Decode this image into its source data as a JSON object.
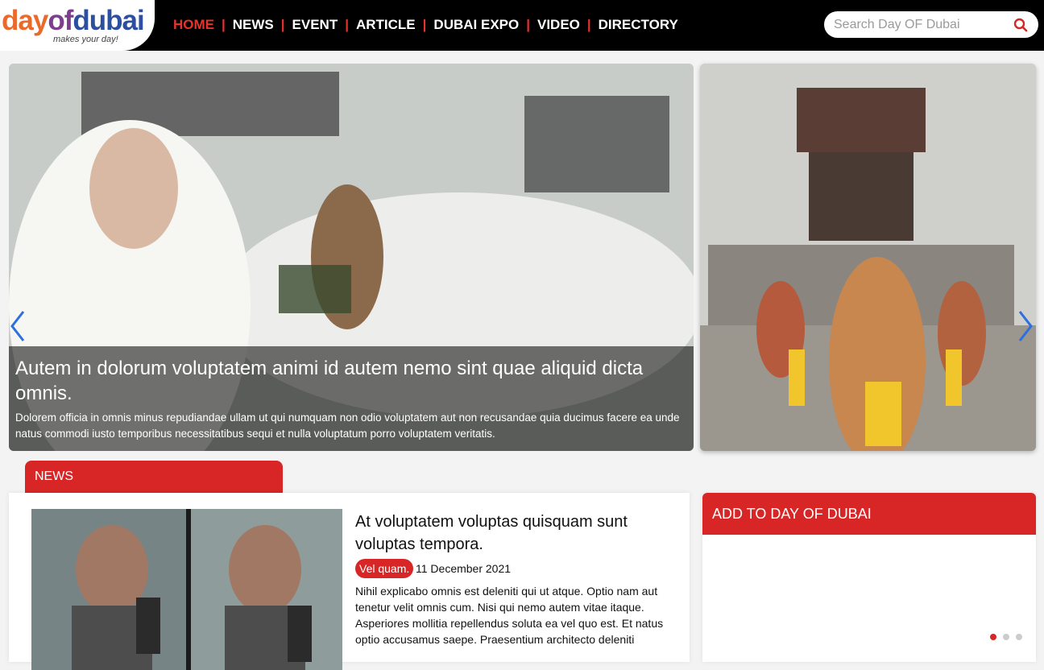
{
  "logo": {
    "part1": "day",
    "part2": "of",
    "part3": "dubai",
    "tagline": "makes your day!"
  },
  "nav": {
    "items": [
      {
        "label": "HOME"
      },
      {
        "label": "NEWS"
      },
      {
        "label": "EVENT"
      },
      {
        "label": "ARTICLE"
      },
      {
        "label": "DUBAI EXPO"
      },
      {
        "label": "VIDEO"
      },
      {
        "label": "DIRECTORY"
      }
    ],
    "separator": "|"
  },
  "search": {
    "placeholder": "Search Day OF Dubai",
    "value": ""
  },
  "hero": {
    "title": "Autem in dolorum voluptatem animi id autem nemo sint quae aliquid dicta omnis.",
    "text": "Dolorem officia in omnis minus repudiandae ullam ut qui numquam non odio voluptatem aut non recusandae quia ducimus facere ea unde natus commodi iusto temporibus necessitatibus sequi et nulla voluptatum porro voluptatem veritatis."
  },
  "news": {
    "tab_label": "NEWS",
    "article": {
      "title": "At voluptatem voluptas quisquam sunt voluptas tempora.",
      "badge": "Vel quam.",
      "date": "11 December 2021",
      "body": "Nihil explicabo omnis est deleniti qui ut atque. Optio nam aut tenetur velit omnis cum. Nisi qui nemo autem vitae itaque. Asperiores mollitia repellendus soluta ea vel quo est. Et natus optio accusamus saepe. Praesentium architecto deleniti"
    }
  },
  "add_panel": {
    "title": "ADD TO DAY OF DUBAI"
  },
  "colors": {
    "accent": "#d82626",
    "nav_active": "#e8332a",
    "header_bg": "#000000"
  }
}
